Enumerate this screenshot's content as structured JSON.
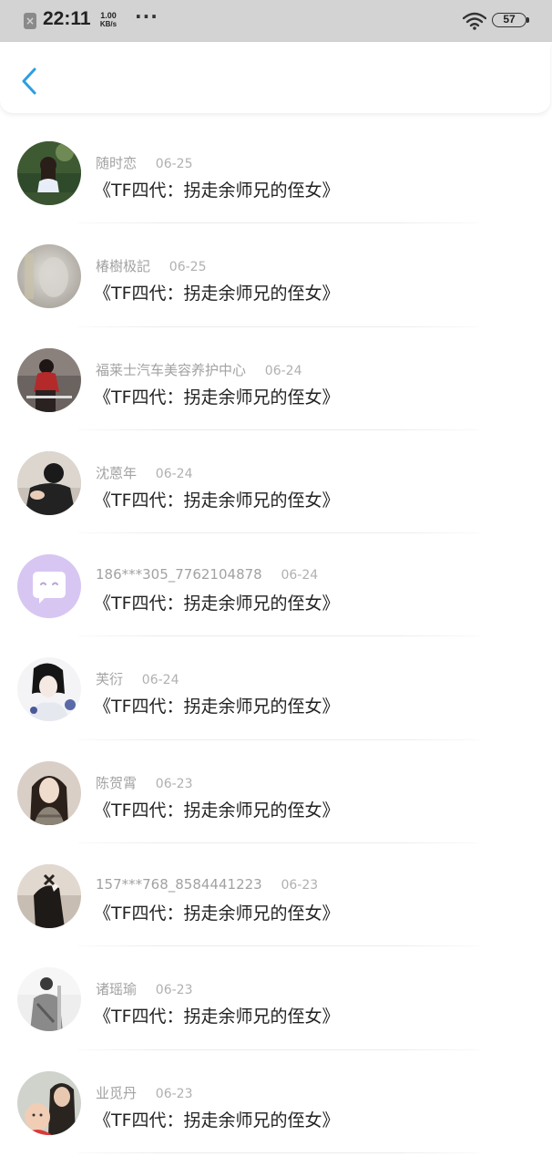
{
  "status_bar": {
    "time": "22:11",
    "speed_value": "1.00",
    "speed_unit": "KB/s",
    "dots": "···",
    "battery": "57"
  },
  "header": {
    "back_icon": "chevron-left-icon",
    "accent_color": "#2a9fe0"
  },
  "comments": [
    {
      "name": "随时恋",
      "date": "06-25",
      "text": "《TF四代：拐走余师兄的侄女》"
    },
    {
      "name": "椿樹极記",
      "date": "06-25",
      "text": "《TF四代：拐走余师兄的侄女》"
    },
    {
      "name": "福莱士汽车美容养护中心",
      "date": "06-24",
      "text": "《TF四代：拐走余师兄的侄女》"
    },
    {
      "name": "沈蒽年",
      "date": "06-24",
      "text": "《TF四代：拐走余师兄的侄女》"
    },
    {
      "name": "186***305_7762104878",
      "date": "06-24",
      "text": "《TF四代：拐走余师兄的侄女》"
    },
    {
      "name": "芙衍",
      "date": "06-24",
      "text": "《TF四代：拐走余师兄的侄女》"
    },
    {
      "name": "陈贺霄",
      "date": "06-23",
      "text": "《TF四代：拐走余师兄的侄女》"
    },
    {
      "name": "157***768_8584441223",
      "date": "06-23",
      "text": "《TF四代：拐走余师兄的侄女》"
    },
    {
      "name": "诸瑶瑜",
      "date": "06-23",
      "text": "《TF四代：拐走余师兄的侄女》"
    },
    {
      "name": "业觅丹",
      "date": "06-23",
      "text": "《TF四代：拐走余师兄的侄女》"
    }
  ]
}
